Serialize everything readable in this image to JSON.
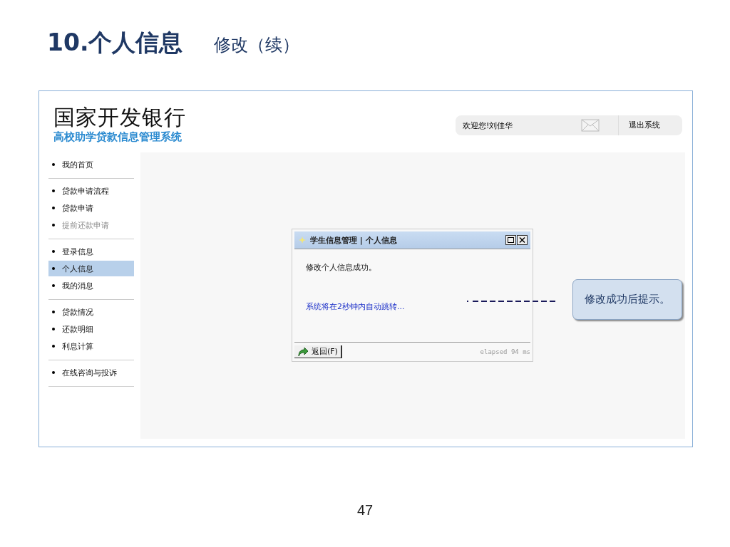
{
  "slide_title": {
    "main": "10.个人信息",
    "sub": "修改（续）"
  },
  "app": {
    "brand": "国家开发银行",
    "subtitle": "高校助学贷款信息管理系统",
    "welcome": "欢迎您!刘佳华",
    "logout": "退出系统"
  },
  "sidebar": {
    "groups": [
      [
        {
          "label": "我的首页",
          "selected": false,
          "disabled": false
        }
      ],
      [
        {
          "label": "贷款申请流程",
          "selected": false,
          "disabled": false
        },
        {
          "label": "贷款申请",
          "selected": false,
          "disabled": false
        },
        {
          "label": "提前还款申请",
          "selected": false,
          "disabled": true
        }
      ],
      [
        {
          "label": "登录信息",
          "selected": false,
          "disabled": false
        },
        {
          "label": "个人信息",
          "selected": true,
          "disabled": false
        },
        {
          "label": "我的消息",
          "selected": false,
          "disabled": false
        }
      ],
      [
        {
          "label": "贷款情况",
          "selected": false,
          "disabled": false
        },
        {
          "label": "还款明细",
          "selected": false,
          "disabled": false
        },
        {
          "label": "利息计算",
          "selected": false,
          "disabled": false
        }
      ],
      [
        {
          "label": "在线咨询与投诉",
          "selected": false,
          "disabled": false
        }
      ]
    ]
  },
  "dialog": {
    "title": "学生信息管理 | 个人信息",
    "message": "修改个人信息成功。",
    "redirect": "系统将在2秒钟内自动跳转...",
    "back_button": "返回(F)",
    "elapsed": "elapsed 94 ms"
  },
  "callout": "修改成功后提示。",
  "page_number": "47"
}
